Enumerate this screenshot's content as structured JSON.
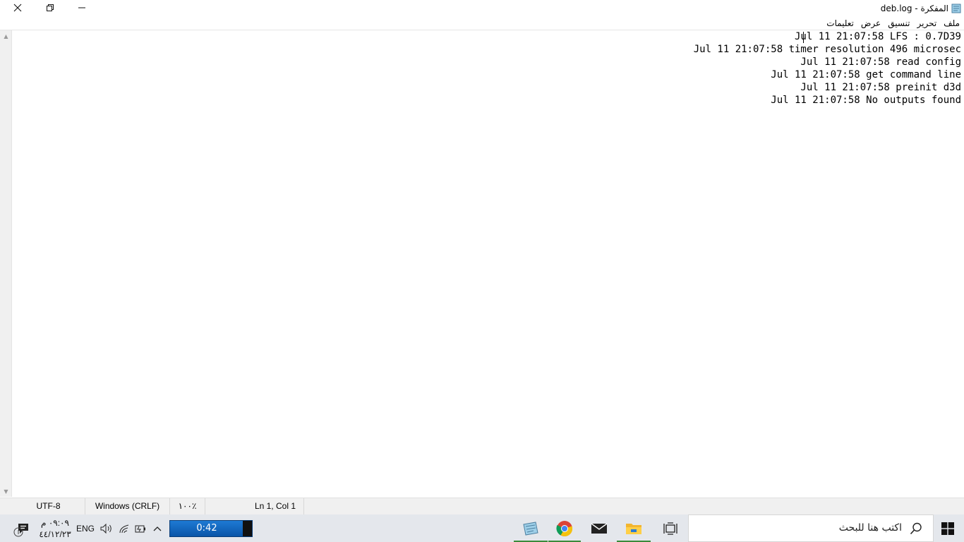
{
  "window": {
    "title": "deb.log - المفكرة"
  },
  "menu": [
    "ملف",
    "تحرير",
    "تنسيق",
    "عرض",
    "تعليمات"
  ],
  "editor": {
    "lines": [
      "Jul 11 21:07:58 LFS : 0.7D39",
      "Jul 11 21:07:58 timer resolution 496 microsec",
      "Jul 11 21:07:58 read config",
      "Jul 11 21:07:58 get command line",
      "Jul 11 21:07:58 preinit d3d",
      "Jul 11 21:07:58 No outputs found"
    ]
  },
  "statusbar": {
    "position": "Ln 1, Col 1",
    "zoom": "١٠٠٪",
    "line_ending": "Windows (CRLF)",
    "encoding": "UTF-8"
  },
  "taskbar": {
    "search_placeholder": "اكتب هنا للبحث",
    "timer": "0:42",
    "language": "ENG",
    "clock_time": "٠٩:٠٩ م",
    "clock_date": "٤٤/١٢/٢٣",
    "accent_color": "#0a55a8"
  },
  "icons": [
    "close-icon",
    "restore-icon",
    "minimize-icon",
    "notepad-icon",
    "chrome-icon",
    "mail-icon",
    "file-explorer-icon",
    "task-view-icon",
    "search-icon",
    "windows-start-icon",
    "notifications-icon",
    "volume-icon",
    "network-icon",
    "battery-icon",
    "chevron-up-icon"
  ]
}
